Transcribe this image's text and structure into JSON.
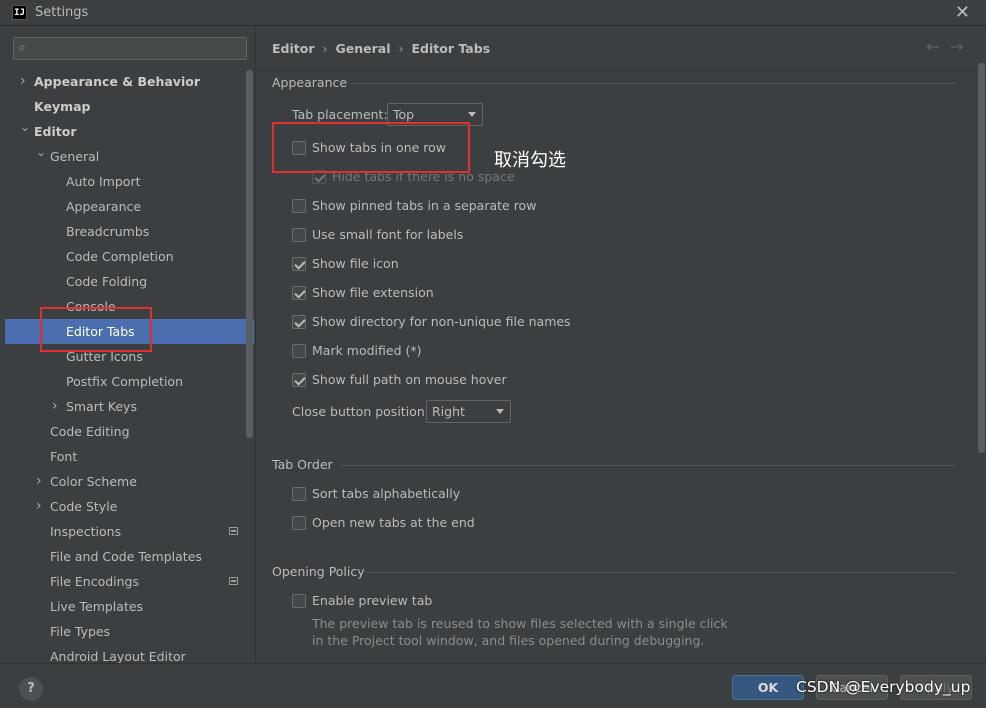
{
  "window": {
    "title": "Settings",
    "app_icon": "IJ",
    "close": "✕"
  },
  "search": {
    "placeholder": "",
    "icon": "search-icon"
  },
  "tree": [
    {
      "label": "Appearance & Behavior",
      "level": 0,
      "chevron": "›",
      "bold": true
    },
    {
      "label": "Keymap",
      "level": 0,
      "chevron": "",
      "bold": true
    },
    {
      "label": "Editor",
      "level": 0,
      "chevron": "⌄",
      "bold": true
    },
    {
      "label": "General",
      "level": 1,
      "chevron": "⌄"
    },
    {
      "label": "Auto Import",
      "level": 2,
      "chevron": ""
    },
    {
      "label": "Appearance",
      "level": 2,
      "chevron": ""
    },
    {
      "label": "Breadcrumbs",
      "level": 2,
      "chevron": ""
    },
    {
      "label": "Code Completion",
      "level": 2,
      "chevron": ""
    },
    {
      "label": "Code Folding",
      "level": 2,
      "chevron": ""
    },
    {
      "label": "Console",
      "level": 2,
      "chevron": ""
    },
    {
      "label": "Editor Tabs",
      "level": 2,
      "chevron": "",
      "selected": true
    },
    {
      "label": "Gutter Icons",
      "level": 2,
      "chevron": ""
    },
    {
      "label": "Postfix Completion",
      "level": 2,
      "chevron": ""
    },
    {
      "label": "Smart Keys",
      "level": 2,
      "chevron": "›"
    },
    {
      "label": "Code Editing",
      "level": 1,
      "chevron": ""
    },
    {
      "label": "Font",
      "level": 1,
      "chevron": ""
    },
    {
      "label": "Color Scheme",
      "level": 1,
      "chevron": "›"
    },
    {
      "label": "Code Style",
      "level": 1,
      "chevron": "›"
    },
    {
      "label": "Inspections",
      "level": 1,
      "chevron": "",
      "badge": true
    },
    {
      "label": "File and Code Templates",
      "level": 1,
      "chevron": ""
    },
    {
      "label": "File Encodings",
      "level": 1,
      "chevron": "",
      "badge": true
    },
    {
      "label": "Live Templates",
      "level": 1,
      "chevron": ""
    },
    {
      "label": "File Types",
      "level": 1,
      "chevron": ""
    },
    {
      "label": "Android Layout Editor",
      "level": 1,
      "chevron": ""
    }
  ],
  "breadcrumb": {
    "items": [
      "Editor",
      "General",
      "Editor Tabs"
    ],
    "sep": "›",
    "back": "←",
    "forward": "→"
  },
  "appearance": {
    "title": "Appearance",
    "tab_placement_label": "Tab placement:",
    "tab_placement_value": "Top",
    "show_tabs_one_row": {
      "label": "Show tabs in one row",
      "checked": false
    },
    "hide_tabs": {
      "label": "Hide tabs if there is no space",
      "checked": true,
      "disabled": true
    },
    "options": [
      {
        "label": "Show pinned tabs in a separate row",
        "checked": false
      },
      {
        "label": "Use small font for labels",
        "checked": false
      },
      {
        "label": "Show file icon",
        "checked": true
      },
      {
        "label": "Show file extension",
        "checked": true
      },
      {
        "label": "Show directory for non-unique file names",
        "checked": true
      },
      {
        "label": "Mark modified (*)",
        "checked": false
      },
      {
        "label": "Show full path on mouse hover",
        "checked": true
      }
    ],
    "close_button_label": "Close button position:",
    "close_button_value": "Right"
  },
  "tab_order": {
    "title": "Tab Order",
    "options": [
      {
        "label": "Sort tabs alphabetically",
        "checked": false
      },
      {
        "label": "Open new tabs at the end",
        "checked": false
      }
    ]
  },
  "opening_policy": {
    "title": "Opening Policy",
    "preview": {
      "label": "Enable preview tab",
      "checked": false
    },
    "description_line1": "The preview tab is reused to show files selected with a single click",
    "description_line2": "in the Project tool window, and files opened during debugging."
  },
  "annotation": "取消勾选",
  "footer": {
    "help": "?",
    "ok": "OK",
    "cancel": "Cancel",
    "apply": "Apply",
    "watermark": "CSDN @Everybody_up"
  },
  "colors": {
    "selection": "#4b6eaf",
    "background": "#3c3f41",
    "annotation_box": "#e03030",
    "ok_button": "#365880"
  }
}
